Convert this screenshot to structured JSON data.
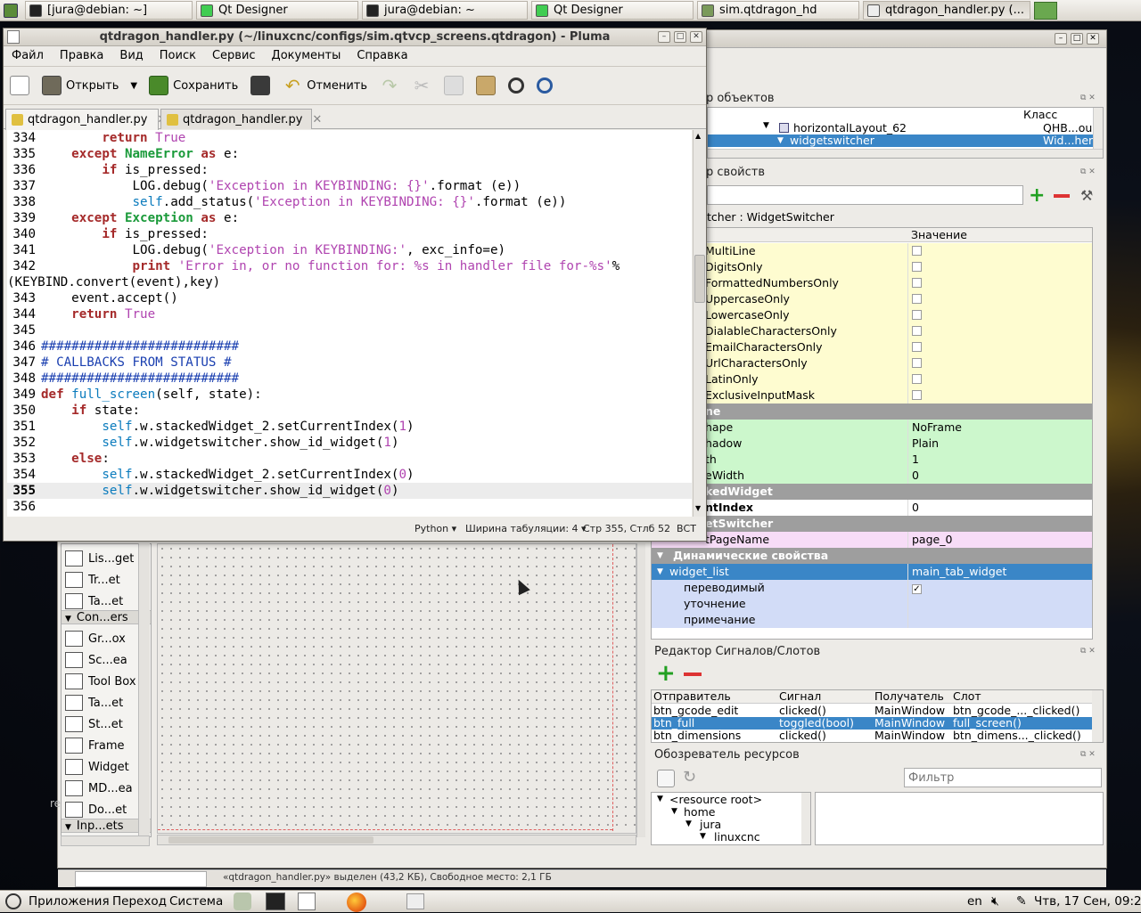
{
  "top_taskbar": {
    "tasks": [
      {
        "label": "[jura@debian: ~]",
        "icon": "terminal-icon"
      },
      {
        "label": "Qt Designer",
        "icon": "qt-icon"
      },
      {
        "label": "jura@debian: ~",
        "icon": "terminal-icon"
      },
      {
        "label": "Qt Designer",
        "icon": "qt-icon"
      },
      {
        "label": "sim.qtdragon_hd",
        "icon": "folder-icon"
      },
      {
        "label": "qtdragon_handler.py (...",
        "icon": "text-editor-icon"
      }
    ]
  },
  "designer": {
    "object_inspector": {
      "title": "р объектов",
      "col_class": "Класс",
      "rows": [
        {
          "name": "horizontalLayout_62",
          "cls": "QHB...ou"
        },
        {
          "name": "widgetswitcher",
          "cls": "Wid...her"
        }
      ]
    },
    "property_editor": {
      "title": "р свойств",
      "object_label": "tcher : WidgetSwitcher",
      "col_value": "Значение",
      "rows": [
        {
          "name": "MultiLine",
          "value": "",
          "type": "check",
          "style": "yel"
        },
        {
          "name": "DigitsOnly",
          "value": "",
          "type": "check",
          "style": "yel"
        },
        {
          "name": "FormattedNumbersOnly",
          "value": "",
          "type": "check",
          "style": "yel"
        },
        {
          "name": "UppercaseOnly",
          "value": "",
          "type": "check",
          "style": "yel"
        },
        {
          "name": "LowercaseOnly",
          "value": "",
          "type": "check",
          "style": "yel"
        },
        {
          "name": "DialableCharactersOnly",
          "value": "",
          "type": "check",
          "style": "yel"
        },
        {
          "name": "EmailCharactersOnly",
          "value": "",
          "type": "check",
          "style": "yel"
        },
        {
          "name": "UrlCharactersOnly",
          "value": "",
          "type": "check",
          "style": "yel"
        },
        {
          "name": "LatinOnly",
          "value": "",
          "type": "check",
          "style": "yel"
        },
        {
          "name": "ExclusiveInputMask",
          "value": "",
          "type": "check",
          "style": "yel"
        },
        {
          "name": "ne",
          "value": "",
          "type": "header",
          "style": "grey"
        },
        {
          "name": "hape",
          "value": "NoFrame",
          "type": "text",
          "style": "grn"
        },
        {
          "name": "hadow",
          "value": "Plain",
          "type": "text",
          "style": "grn"
        },
        {
          "name": "th",
          "value": "1",
          "type": "text",
          "style": "grn"
        },
        {
          "name": "eWidth",
          "value": "0",
          "type": "text",
          "style": "grn"
        },
        {
          "name": "kedWidget",
          "value": "",
          "type": "header",
          "style": "grey"
        },
        {
          "name": "ntIndex",
          "value": "0",
          "type": "text",
          "style": "bold"
        },
        {
          "name": "etSwitcher",
          "value": "",
          "type": "header",
          "style": "grey"
        },
        {
          "name": "tPageName",
          "value": "page_0",
          "type": "text",
          "style": "pur"
        },
        {
          "name": "Динамические свойства",
          "value": "",
          "type": "header",
          "style": "grey"
        },
        {
          "name": "widget_list",
          "value": "main_tab_widget",
          "type": "text",
          "style": "sel"
        },
        {
          "name": "переводимый",
          "value": "✓",
          "type": "check",
          "style": "blu"
        },
        {
          "name": "уточнение",
          "value": "",
          "type": "text",
          "style": "blu"
        },
        {
          "name": "примечание",
          "value": "",
          "type": "text",
          "style": "blu"
        }
      ]
    },
    "signal_slot_editor": {
      "title": "Редактор Сигналов/Слотов",
      "columns": [
        "Отправитель",
        "Сигнал",
        "Получатель",
        "Слот"
      ],
      "rows": [
        [
          "btn_gcode_edit",
          "clicked()",
          "MainWindow",
          "btn_gcode_..._clicked()"
        ],
        [
          "btn_full",
          "toggled(bool)",
          "MainWindow",
          "full_screen()"
        ],
        [
          "btn_dimensions",
          "clicked()",
          "MainWindow",
          "btn_dimens..._clicked()"
        ]
      ]
    },
    "resource_browser": {
      "title": "Обозреватель ресурсов",
      "filter_placeholder": "Фильтр",
      "tree": [
        "<resource root>",
        "home",
        "jura",
        "linuxcnc"
      ]
    },
    "widget_box": {
      "items": [
        {
          "label": "Lis...get",
          "kind": "item"
        },
        {
          "label": "Tr...et",
          "kind": "item"
        },
        {
          "label": "Ta...et",
          "kind": "item"
        },
        {
          "label": "Con...ers",
          "kind": "category"
        },
        {
          "label": "Gr...ox",
          "kind": "item"
        },
        {
          "label": "Sc...ea",
          "kind": "item"
        },
        {
          "label": "Tool Box",
          "kind": "item"
        },
        {
          "label": "Ta...et",
          "kind": "item"
        },
        {
          "label": "St...et",
          "kind": "item"
        },
        {
          "label": "Frame",
          "kind": "item"
        },
        {
          "label": "Widget",
          "kind": "item"
        },
        {
          "label": "MD...ea",
          "kind": "item"
        },
        {
          "label": "Do...et",
          "kind": "item"
        },
        {
          "label": "Inp...ets",
          "kind": "category"
        }
      ]
    },
    "status_bar": "«qtdragon_handler.py» выделен (43,2 КБ), Свободное место: 2,1 ГБ",
    "left_edge_text": "re"
  },
  "pluma": {
    "title": "qtdragon_handler.py (~/linuxcnc/configs/sim.qtvcp_screens.qtdragon) - Pluma",
    "menu": [
      "Файл",
      "Правка",
      "Вид",
      "Поиск",
      "Сервис",
      "Документы",
      "Справка"
    ],
    "toolbar": {
      "open": "Открыть",
      "save": "Сохранить",
      "undo": "Отменить"
    },
    "tabs": [
      "qtdragon_handler.py",
      "qtdragon_handler.py"
    ],
    "code_lines": [
      {
        "n": "334",
        "t": [
          [
            "        ",
            ""
          ],
          [
            "return",
            "kw"
          ],
          [
            " ",
            ""
          ],
          [
            "True",
            "cn"
          ]
        ]
      },
      {
        "n": "335",
        "t": [
          [
            "    ",
            ""
          ],
          [
            "except",
            "kw"
          ],
          [
            " ",
            ""
          ],
          [
            "NameError",
            "bi"
          ],
          [
            " ",
            ""
          ],
          [
            "as",
            "kw"
          ],
          [
            " e:",
            ""
          ]
        ]
      },
      {
        "n": "336",
        "t": [
          [
            "        ",
            ""
          ],
          [
            "if",
            "kw"
          ],
          [
            " is_pressed:",
            ""
          ]
        ]
      },
      {
        "n": "337",
        "t": [
          [
            "            LOG.debug(",
            ""
          ],
          [
            "'Exception in KEYBINDING: {}'",
            "st"
          ],
          [
            ".format (e))",
            ""
          ]
        ]
      },
      {
        "n": "338",
        "t": [
          [
            "            ",
            ""
          ],
          [
            "self",
            "sf"
          ],
          [
            ".add_status(",
            ""
          ],
          [
            "'Exception in KEYBINDING: {}'",
            "st"
          ],
          [
            ".format (e))",
            ""
          ]
        ]
      },
      {
        "n": "339",
        "t": [
          [
            "    ",
            ""
          ],
          [
            "except",
            "kw"
          ],
          [
            " ",
            ""
          ],
          [
            "Exception",
            "bi"
          ],
          [
            " ",
            ""
          ],
          [
            "as",
            "kw"
          ],
          [
            " e:",
            ""
          ]
        ]
      },
      {
        "n": "340",
        "t": [
          [
            "        ",
            ""
          ],
          [
            "if",
            "kw"
          ],
          [
            " is_pressed:",
            ""
          ]
        ]
      },
      {
        "n": "341",
        "t": [
          [
            "            LOG.debug(",
            ""
          ],
          [
            "'Exception in KEYBINDING:'",
            "st"
          ],
          [
            ", exc_info=e)",
            ""
          ]
        ]
      },
      {
        "n": "342",
        "t": [
          [
            "            ",
            ""
          ],
          [
            "print",
            "kw"
          ],
          [
            " ",
            ""
          ],
          [
            "'Error in, or no function for: %s in handler file for-%s'",
            "st"
          ],
          [
            "%",
            ""
          ]
        ]
      },
      {
        "n": "",
        "t": [
          [
            "(KEYBIND.convert(event),key)",
            ""
          ]
        ]
      },
      {
        "n": "343",
        "t": [
          [
            "    event.accept()",
            ""
          ]
        ]
      },
      {
        "n": "344",
        "t": [
          [
            "    ",
            ""
          ],
          [
            "return",
            "kw"
          ],
          [
            " ",
            ""
          ],
          [
            "True",
            "cn"
          ]
        ]
      },
      {
        "n": "345",
        "t": [
          [
            "",
            ""
          ]
        ]
      },
      {
        "n": "346",
        "t": [
          [
            "##########################",
            "cm"
          ]
        ]
      },
      {
        "n": "347",
        "t": [
          [
            "# CALLBACKS FROM STATUS #",
            "cm"
          ]
        ]
      },
      {
        "n": "348",
        "t": [
          [
            "##########################",
            "cm"
          ]
        ]
      },
      {
        "n": "349",
        "t": [
          [
            "",
            ""
          ],
          [
            "def",
            "kw"
          ],
          [
            " ",
            ""
          ],
          [
            "full_screen",
            "fn"
          ],
          [
            "(self, state):",
            ""
          ]
        ]
      },
      {
        "n": "350",
        "t": [
          [
            "    ",
            ""
          ],
          [
            "if",
            "kw"
          ],
          [
            " state:",
            ""
          ]
        ]
      },
      {
        "n": "351",
        "t": [
          [
            "        ",
            ""
          ],
          [
            "self",
            "sf"
          ],
          [
            ".w.stackedWidget_2.setCurrentIndex(",
            ""
          ],
          [
            "1",
            "nu"
          ],
          [
            ")",
            ""
          ]
        ]
      },
      {
        "n": "352",
        "t": [
          [
            "        ",
            ""
          ],
          [
            "self",
            "sf"
          ],
          [
            ".w.widgetswitcher.show_id_widget(",
            ""
          ],
          [
            "1",
            "nu"
          ],
          [
            ")",
            ""
          ]
        ]
      },
      {
        "n": "353",
        "t": [
          [
            "    ",
            ""
          ],
          [
            "else",
            "kw"
          ],
          [
            ":",
            ""
          ]
        ]
      },
      {
        "n": "354",
        "t": [
          [
            "        ",
            ""
          ],
          [
            "self",
            "sf"
          ],
          [
            ".w.stackedWidget_2.setCurrentIndex(",
            ""
          ],
          [
            "0",
            "nu"
          ],
          [
            ")",
            ""
          ]
        ]
      },
      {
        "n": "355",
        "t": [
          [
            "        ",
            ""
          ],
          [
            "self",
            "sf"
          ],
          [
            ".w.widgetswitcher.show_id_widget(",
            ""
          ],
          [
            "0",
            "nu"
          ],
          [
            ")",
            ""
          ]
        ]
      },
      {
        "n": "356",
        "t": [
          [
            "",
            ""
          ]
        ]
      }
    ],
    "status": {
      "language": "Python",
      "tab_width": "Ширина табуляции:  4",
      "position": "Стр 355, Стлб 52",
      "mode": "ВСТ"
    }
  },
  "bottom_panel": {
    "menus": [
      "Приложения",
      "Переход",
      "Система"
    ],
    "keyboard_layout": "en",
    "clock": "Чтв, 17 Сен, 09:22"
  },
  "colors": {
    "selection": "#3a86c7",
    "keyword": "#a52a2a",
    "string": "#b044b0",
    "comment": "#1a3fb0",
    "self": "#0a7bbd"
  }
}
